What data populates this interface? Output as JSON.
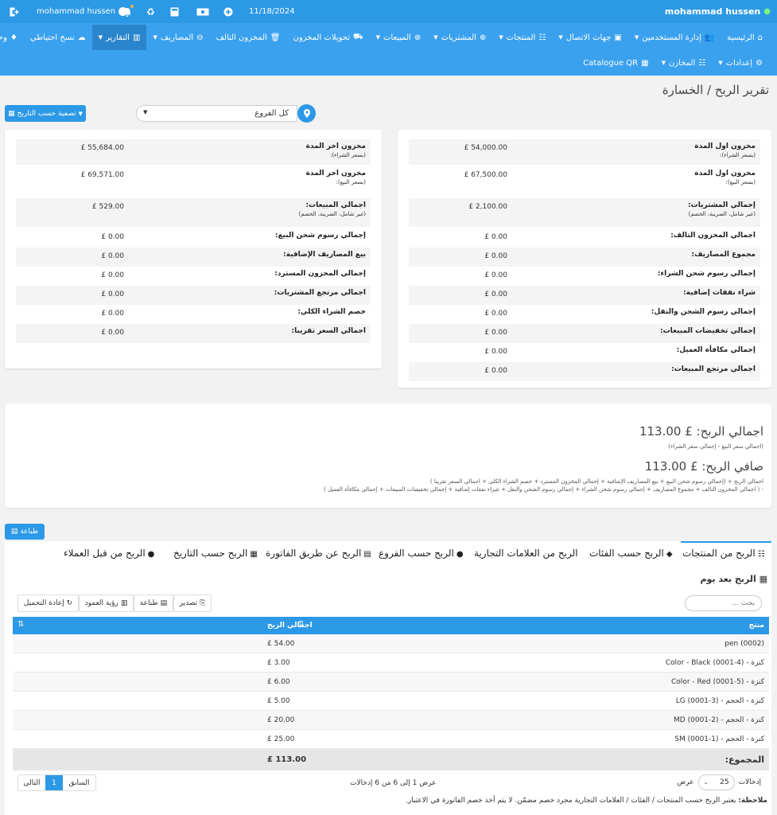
{
  "topbar": {
    "user_right": "mohammad hussen",
    "user_left": "mohammad hussen",
    "date": "11/18/2024"
  },
  "nav": {
    "row1": [
      {
        "icon": "⌂",
        "label": "الرئيسية",
        "caret": false
      },
      {
        "icon": "👥",
        "label": "إدارة المستخدمين",
        "caret": true
      },
      {
        "icon": "▣",
        "label": "جهات الاتصال",
        "caret": true
      },
      {
        "icon": "☷",
        "label": "المنتجات",
        "caret": true
      },
      {
        "icon": "⊕",
        "label": "المشتريات",
        "caret": true
      },
      {
        "icon": "⊕",
        "label": "المبيعات",
        "caret": true
      },
      {
        "icon": "⛟",
        "label": "تحويلات المخزون",
        "caret": false
      },
      {
        "icon": "🗑",
        "label": "المخزون التالف",
        "caret": false
      },
      {
        "icon": "⊖",
        "label": "المصاريف",
        "caret": true
      },
      {
        "icon": "▥",
        "label": "التقارير",
        "caret": true
      },
      {
        "icon": "☁",
        "label": "نسخ احتياطي",
        "caret": false
      },
      {
        "icon": "♦",
        "label": "وحدات",
        "caret": false
      }
    ],
    "row2": [
      {
        "icon": "⚙",
        "label": "إعدادات",
        "caret": true
      },
      {
        "icon": "☷",
        "label": "المخازن",
        "caret": true
      },
      {
        "icon": "▦",
        "label": "Catalogue QR",
        "caret": false
      }
    ]
  },
  "page": {
    "title": "تقرير الربح / الخسارة",
    "branch": "كل الفروع",
    "filter_btn": "تصفية حسب التاريخ"
  },
  "right_rows": [
    {
      "label": "مخزون اول المدة",
      "sub": "(بسعر الشراء):",
      "value": "54,000.00 £"
    },
    {
      "label": "مخزون اول المدة",
      "sub": "(بسعر البيع):",
      "value": "67,500.00 £"
    },
    {
      "label": "إجمالي المشتريات:",
      "sub": "(غير شامل، الضريبة، الخصم)",
      "value": "2,100.00 £"
    },
    {
      "label": "اجمالي المخزون التالف:",
      "sub": "",
      "value": "0.00 £"
    },
    {
      "label": "مجموع المصاريف:",
      "sub": "",
      "value": "0.00 £"
    },
    {
      "label": "إجمالي رسوم شحن الشراء:",
      "sub": "",
      "value": "0.00 £"
    },
    {
      "label": "شراء نفقات إضافية:",
      "sub": "",
      "value": "0.00 £"
    },
    {
      "label": "إجمالي رسوم الشحن والنقل:",
      "sub": "",
      "value": "0.00 £"
    },
    {
      "label": "إجمالي تخفيضات المبيعات:",
      "sub": "",
      "value": "0.00 £"
    },
    {
      "label": "إجمالي مكافأة العميل:",
      "sub": "",
      "value": "0.00 £"
    },
    {
      "label": "اجمالي مرتجع المبيعات:",
      "sub": "",
      "value": "0.00 £"
    }
  ],
  "left_rows": [
    {
      "label": "مخزون اخر المدة",
      "sub": "(بسعر الشراء):",
      "value": "55,684.00 £"
    },
    {
      "label": "مخزون اخر المدة",
      "sub": "(بسعر البيع):",
      "value": "69,571.00 £"
    },
    {
      "label": "اجمالي المبيعات:",
      "sub": "(غير شامل، الضريبة، الخصم)",
      "value": "529.00 £"
    },
    {
      "label": "إجمالي رسوم شحن البيع:",
      "sub": "",
      "value": "0.00 £"
    },
    {
      "label": "بيع المصاريف الإضافية:",
      "sub": "",
      "value": "0.00 £"
    },
    {
      "label": "إجمالي المخزون المسترد:",
      "sub": "",
      "value": "0.00 £"
    },
    {
      "label": "اجمالي مرتجع المشتريات:",
      "sub": "",
      "value": "0.00 £"
    },
    {
      "label": "خصم الشراء الكلي:",
      "sub": "",
      "value": "0.00 £"
    },
    {
      "label": "اجمالي السعر تقريبا:",
      "sub": "",
      "value": "0.00 £"
    }
  ],
  "summary": {
    "gross_title": "اجمالي الربح: £ 113.00",
    "gross_note": "(اجمالي سعر البيع - إجمالي سعر الشراء)",
    "net_title": "صافي الربح: £ 113.00",
    "net_note1": "اجمالي الربح + (إجمالي رسوم شحن البيع + بيع المصاريف الإضافية + إجمالي المخزون المسترد + خصم الشراء الكلي + اجمالي السعر تقريبا )",
    "net_note2": "- ( اجمالي المخزون التالف + مجموع المصاريف + إجمالي رسوم شحن الشراء + إجمالي رسوم الشحن والنقل + شراء نفقات إضافية + إجمالي تخفيضات المبيعات + إجمالي مكافأة العميل )"
  },
  "print_btn": "طباعة",
  "tabs": [
    {
      "icon": "☷",
      "label": "الربح من المنتجات"
    },
    {
      "icon": "◆",
      "label": "الربح حسب الفئات"
    },
    {
      "icon": "",
      "label": "الربح من العلامات التجارية"
    },
    {
      "icon": "●",
      "label": "الربح حسب الفروع"
    },
    {
      "icon": "▤",
      "label": "الربح عن طريق الفاتورة"
    },
    {
      "icon": "▦",
      "label": "الربح حسب التاريخ"
    },
    {
      "icon": "●",
      "label": "الربح من قبل العملاء"
    }
  ],
  "subtab": "الربح بعد يوم",
  "toolbar": {
    "export": "تصدير",
    "print": "طباعة",
    "columns": "رؤية العمود",
    "reload": "إعادة التحميل",
    "search_placeholder": "بحث ..."
  },
  "table": {
    "headers": [
      "منتج",
      "اجمالي الربح"
    ],
    "rows": [
      [
        "pen (0002)",
        "54.00 £"
      ],
      [
        "كنزة - Color - Black (0001-4)",
        "3.00 £"
      ],
      [
        "كنزة - Color - Red (0001-5)",
        "6.00 £"
      ],
      [
        "كنزة - الحجم - LG (0001-3)",
        "5.00 £"
      ],
      [
        "كنزة - الحجم - MD (0001-2)",
        "20.00 £"
      ],
      [
        "كنزة - الحجم - SM (0001-1)",
        "25.00 £"
      ]
    ],
    "total_label": "المجموع:",
    "total_value": "113.00 £"
  },
  "pagination": {
    "show": "عرض",
    "entries": "إدخالات",
    "page_size": "25",
    "info": "عرض 1 إلى 6 من 6 إدخالات",
    "prev": "السابق",
    "page": "1",
    "next": "التالي"
  },
  "note": {
    "bold": "ملاحظة:",
    "text": " يعتبر الربح حسب المنتجات / الفئات / العلامات التجارية مجرد خصم مضمّن. لا يتم أخذ خصم الفاتورة في الاعتبار."
  }
}
